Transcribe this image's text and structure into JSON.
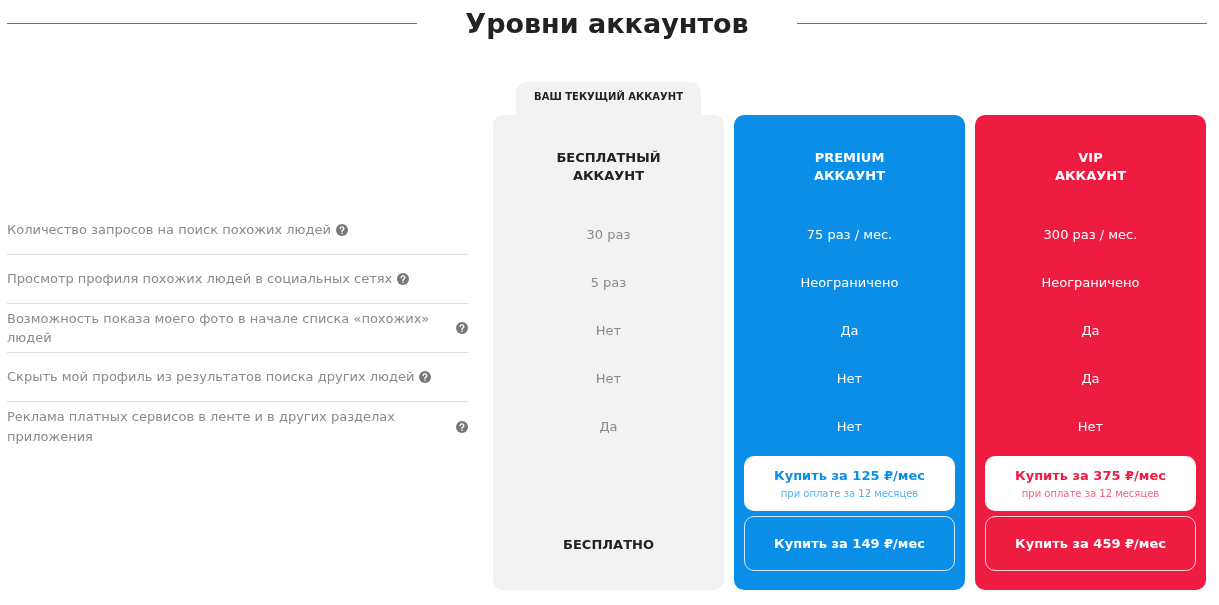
{
  "title": "Уровни аккаунтов",
  "features": [
    {
      "label": "Количество запросов на поиск похожих людей"
    },
    {
      "label": "Просмотр профиля похожих людей в социальных сетях"
    },
    {
      "label": "Возможность показа моего фото в начале списка «похожих» людей"
    },
    {
      "label": "Скрыть мой профиль из результатов поиска других людей"
    },
    {
      "label": "Реклама платных сервисов в ленте и в других разделах приложения"
    }
  ],
  "plans": [
    {
      "kind": "free",
      "current": true,
      "current_label": "ВАШ ТЕКУЩИЙ АККАУНТ",
      "name_lines": [
        "БЕСПЛАТНЫЙ",
        "АККАУНТ"
      ],
      "values": [
        "30 раз",
        "5 раз",
        "Нет",
        "Нет",
        "Да"
      ],
      "price_label": "БЕСПЛАТНО"
    },
    {
      "kind": "premium",
      "current": false,
      "name_lines": [
        "PREMIUM",
        "АККАУНТ"
      ],
      "values": [
        "75 раз / мес.",
        "Неограничено",
        "Да",
        "Нет",
        "Нет"
      ],
      "buttons": [
        {
          "kind": "annual",
          "label": "Купить за 125 ₽/мес",
          "note": "при оплате за 12 месяцев"
        },
        {
          "kind": "monthly",
          "label": "Купить за 149 ₽/мес"
        }
      ]
    },
    {
      "kind": "vip",
      "current": false,
      "name_lines": [
        "VIP",
        "АККАУНТ"
      ],
      "values": [
        "300 раз / мес.",
        "Неограничено",
        "Да",
        "Да",
        "Нет"
      ],
      "buttons": [
        {
          "kind": "annual",
          "label": "Купить за 375 ₽/мес",
          "note": "при оплате за 12 месяцев"
        },
        {
          "kind": "monthly",
          "label": "Купить за 459 ₽/мес"
        }
      ]
    }
  ]
}
